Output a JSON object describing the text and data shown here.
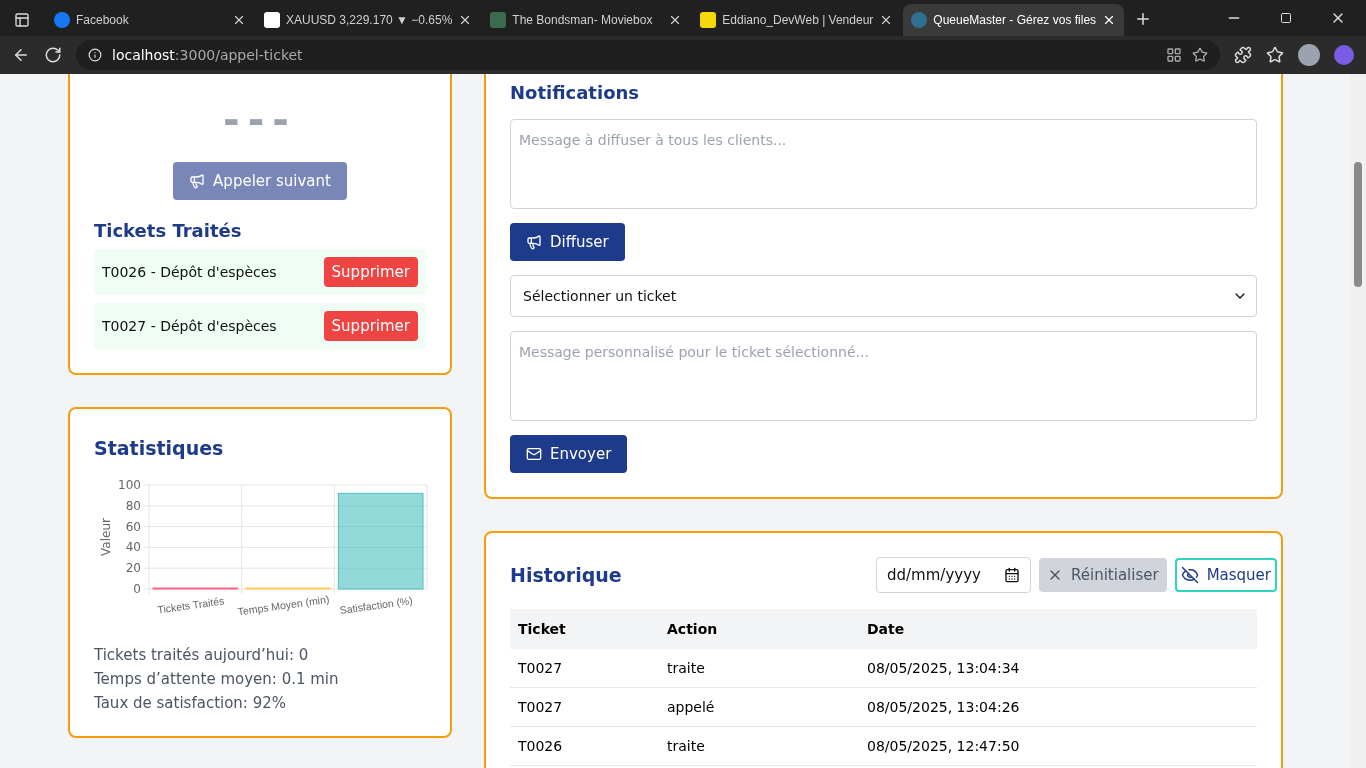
{
  "browser": {
    "tabs": [
      {
        "title": "Facebook",
        "selected": false
      },
      {
        "title": "XAUUSD 3,229.170 ▼ −0.65%",
        "selected": false
      },
      {
        "title": "The Bondsman- Moviebox",
        "selected": false
      },
      {
        "title": "Eddiano_DevWeb | Vendeur",
        "selected": false
      },
      {
        "title": "QueueMaster - Gérez vos files",
        "selected": true
      }
    ],
    "url": "**localhost**:3000/appel-ticket"
  },
  "current_ticket": "---",
  "call_next_button": "Appeler suivant",
  "treated": {
    "title": "Tickets Traités",
    "items": [
      {
        "label": "T0026 - Dépôt d'espèces",
        "action": "Supprimer"
      },
      {
        "label": "T0027 - Dépôt d'espèces",
        "action": "Supprimer"
      }
    ]
  },
  "stats": {
    "title": "Statistiques",
    "chart_data": {
      "type": "bar",
      "grid": true,
      "ylabel": "Valeur",
      "categories": [
        "Tickets Traités",
        "Temps Moyen (min)",
        "Satisfaction (%)"
      ],
      "values": [
        0,
        0,
        92
      ],
      "colors": [
        "#ff6384",
        "#ffcd56",
        "#4bc0c0"
      ],
      "ylim": [
        0,
        100
      ],
      "yticks": [
        0,
        20,
        40,
        60,
        80,
        100
      ]
    },
    "lines": [
      "Tickets traités aujourd’hui: 0",
      "Temps d’attente moyen: 0.1 min",
      "Taux de satisfaction: 92%"
    ]
  },
  "notifications": {
    "title": "Notifications",
    "broadcast_placeholder": "Message à diffuser à tous les clients...",
    "broadcast_button": "Diffuser",
    "ticket_select": "Sélectionner un ticket",
    "message_placeholder": "Message personnalisé pour le ticket sélectionné...",
    "send_button": "Envoyer"
  },
  "history": {
    "title": "Historique",
    "date_placeholder": "dd/mm/yyyy",
    "reset_button": "Réinitialiser",
    "hide_button": "Masquer",
    "columns": [
      "Ticket",
      "Action",
      "Date"
    ],
    "rows": [
      [
        "T0027",
        "traite",
        "08/05/2025, 13:04:34"
      ],
      [
        "T0027",
        "appelé",
        "08/05/2025, 13:04:26"
      ],
      [
        "T0026",
        "traite",
        "08/05/2025, 12:47:50"
      ]
    ]
  }
}
